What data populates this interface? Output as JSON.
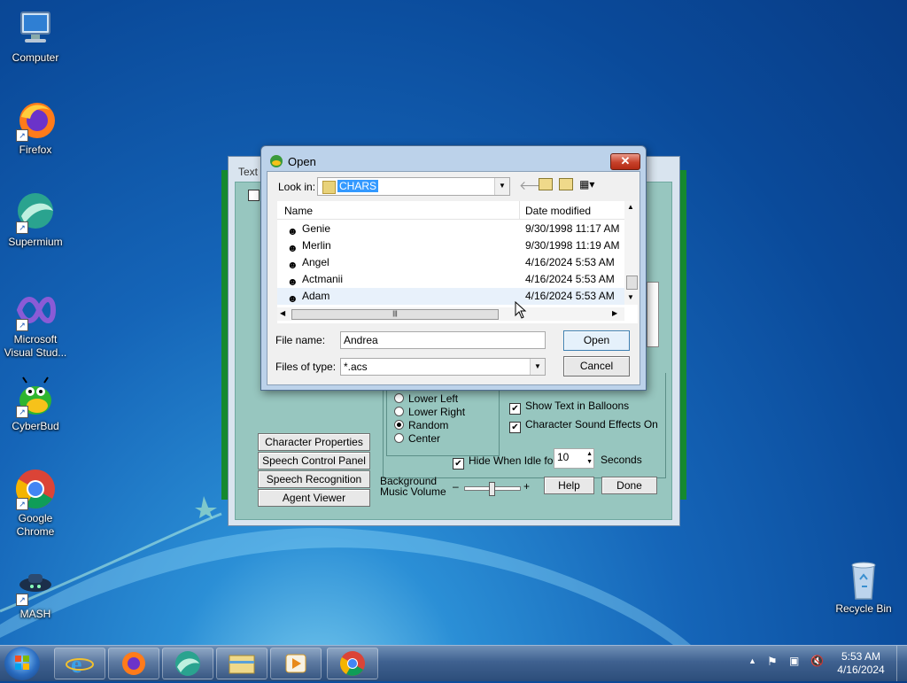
{
  "desktop": {
    "icons": [
      {
        "label": "Computer"
      },
      {
        "label": "Firefox"
      },
      {
        "label": "Supermium"
      },
      {
        "label": "Microsoft Visual Stud..."
      },
      {
        "label": "CyberBud"
      },
      {
        "label": "Google Chrome"
      },
      {
        "label": "MASH"
      },
      {
        "label": "Recycle Bin"
      }
    ]
  },
  "agent_window": {
    "title_fragment": "Text",
    "buttons": {
      "character_properties": "Character Properties",
      "speech_control_panel": "Speech Control Panel",
      "speech_recognition": "Speech Recognition",
      "agent_viewer": "Agent Viewer",
      "help": "Help",
      "done": "Done"
    },
    "positions": [
      {
        "label": "Lower Left",
        "selected": false
      },
      {
        "label": "Lower Right",
        "selected": false
      },
      {
        "label": "Random",
        "selected": true
      },
      {
        "label": "Center",
        "selected": false
      }
    ],
    "checks": {
      "show_text": "Show Text in Balloons",
      "sound_effects": "Character Sound Effects On",
      "hide_idle": "Hide When Idle for"
    },
    "idle_value": "10",
    "seconds_label": "Seconds",
    "bg_music_label_1": "Background",
    "bg_music_label_2": "Music Volume",
    "minus": "–",
    "plus": "+"
  },
  "open_dialog": {
    "title": "Open",
    "look_in_label": "Look in:",
    "look_in_value": "CHARS",
    "columns": {
      "name": "Name",
      "date": "Date modified"
    },
    "files": [
      {
        "name": "Genie",
        "date": "9/30/1998 11:17 AM"
      },
      {
        "name": "Merlin",
        "date": "9/30/1998 11:19 AM"
      },
      {
        "name": "Angel",
        "date": "4/16/2024 5:53 AM"
      },
      {
        "name": "Actmanii",
        "date": "4/16/2024 5:53 AM"
      },
      {
        "name": "Adam",
        "date": "4/16/2024 5:53 AM"
      }
    ],
    "file_name_label": "File name:",
    "file_name_value": "Andrea",
    "files_of_type_label": "Files of type:",
    "files_of_type_value": "*.acs",
    "open_button": "Open",
    "cancel_button": "Cancel",
    "close_glyph": "✕"
  },
  "taskbar": {
    "time": "5:53 AM",
    "date": "4/16/2024"
  },
  "colors": {
    "desktop_blue": "#1565b8",
    "agent_teal": "#97c6bf",
    "selection_blue": "#3399ff"
  }
}
